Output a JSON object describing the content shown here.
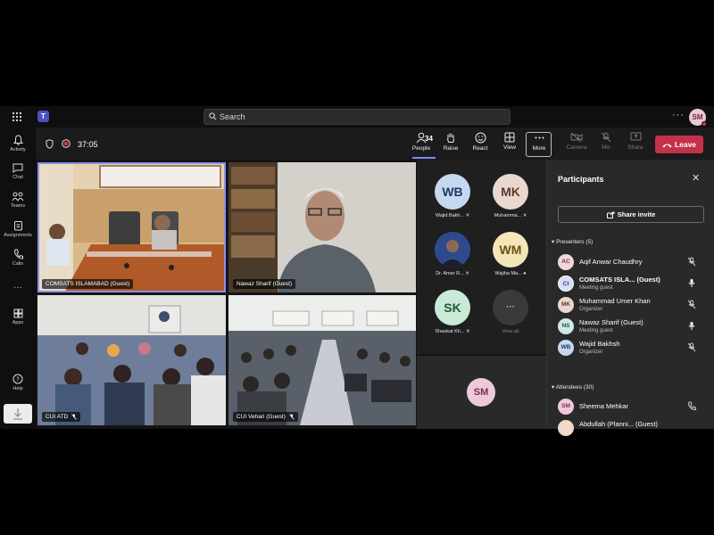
{
  "topbar": {
    "search_placeholder": "Search",
    "more": "···",
    "user_initials": "SM",
    "app_logo": "T"
  },
  "rail": [
    {
      "label": "Activity",
      "icon": "bell-icon"
    },
    {
      "label": "Chat",
      "icon": "chat-icon"
    },
    {
      "label": "Teams",
      "icon": "teams-icon"
    },
    {
      "label": "Assignments",
      "icon": "assignments-icon"
    },
    {
      "label": "Calls",
      "icon": "phone-icon"
    },
    {
      "label": "···",
      "icon": "more-icon"
    },
    {
      "label": "Apps",
      "icon": "apps-icon"
    },
    {
      "label": "Help",
      "icon": "help-icon"
    }
  ],
  "meeting": {
    "timer": "37:05",
    "people_count": "34",
    "buttons": {
      "people": "People",
      "raise": "Raise",
      "react": "React",
      "view": "View",
      "more": "More",
      "camera": "Camera",
      "mic": "Mic",
      "share": "Share",
      "leave": "Leave"
    }
  },
  "tiles": [
    {
      "label": "COMSATS ISLAMABAD (Guest)"
    },
    {
      "label": "Nawaz Sharif (Guest)"
    },
    {
      "label": "CUI ATD"
    },
    {
      "label": "CUI Vehari (Guest)"
    }
  ],
  "gallery": [
    {
      "initials": "WB",
      "name": "Wajid Bakh..."
    },
    {
      "initials": "MK",
      "name": "Muhamma..."
    },
    {
      "initials": "",
      "name": "Dr. Amer R..."
    },
    {
      "initials": "WM",
      "name": "Wajiha Ma..."
    },
    {
      "initials": "SK",
      "name": "Shaukat Kh..."
    },
    {
      "initials": "···",
      "name": "View all"
    }
  ],
  "self": {
    "initials": "SM"
  },
  "participants": {
    "title": "Participants",
    "share_invite": "Share invite",
    "presenters_label": "Presenters (5)",
    "attendees_label": "Attendees (30)",
    "presenters": [
      {
        "initials": "AC",
        "name": "Aqif Anwar Chaudhry",
        "role": ""
      },
      {
        "initials": "CI",
        "name": "COMSATS ISLA...    (Guest)",
        "role": "Meeting guest"
      },
      {
        "initials": "MK",
        "name": "Muhammad Umer Khan",
        "role": "Organizer"
      },
      {
        "initials": "NS",
        "name": "Nawaz Sharif (Guest)",
        "role": "Meeting guest"
      },
      {
        "initials": "WB",
        "name": "Wajid Bakhsh",
        "role": "Organizer"
      }
    ],
    "attendees": [
      {
        "initials": "SM",
        "name": "Sheema Mehkar",
        "role": ""
      },
      {
        "initials": "",
        "name": "Abdullah (Planni...   (Guest)",
        "role": ""
      }
    ]
  },
  "colors": {
    "leave": "#c4314b",
    "accent": "#7f85f5",
    "recording": "#d13438"
  }
}
